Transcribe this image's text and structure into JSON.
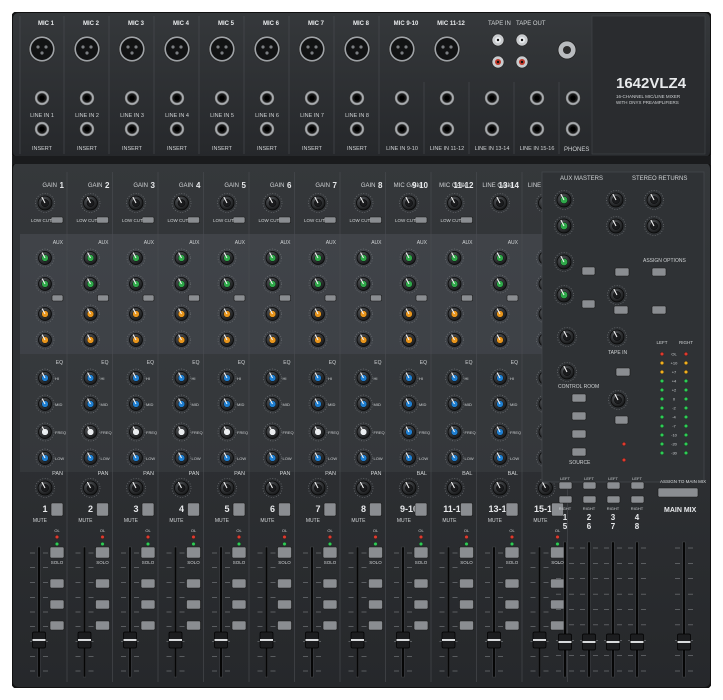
{
  "brand": {
    "model": "1642VLZ4",
    "tagline": "16-CHANNEL MIC/LINE MIXER",
    "tagline2": "WITH ONYX PREAMPLIFIERS"
  },
  "top_panel": {
    "mic_labels": [
      "MIC 1",
      "MIC 2",
      "MIC 3",
      "MIC 4",
      "MIC 5",
      "MIC 6",
      "MIC 7",
      "MIC 8",
      "MIC 9-10",
      "MIC 11-12"
    ],
    "line_in_labels": [
      "LINE IN 1",
      "LINE IN 2",
      "LINE IN 3",
      "LINE IN 4",
      "LINE IN 5",
      "LINE IN 6",
      "LINE IN 7",
      "LINE IN 8"
    ],
    "stereo_line_labels": [
      "LINE IN 9-10",
      "LINE IN 11-12",
      "LINE IN 13-14",
      "LINE IN 15-16"
    ],
    "insert_label": "INSERT",
    "tape_in": "TAPE IN",
    "tape_out": "TAPE OUT",
    "phones": "PHONES"
  },
  "channel_strip": {
    "gain": "GAIN",
    "mic_gain": "MIC GAIN",
    "line_gain": "LINE GAIN",
    "low_cut": "LOW CUT",
    "aux": "AUX",
    "eq": "EQ",
    "pan": "PAN",
    "bal": "BAL",
    "mute": "MUTE",
    "solo": "SOLO",
    "ol": "OL",
    "eq_labels": [
      "HI",
      "MID",
      "FREQ",
      "LOW"
    ],
    "channel_numbers": [
      "1",
      "2",
      "3",
      "4",
      "5",
      "6",
      "7",
      "8",
      "9-10",
      "11-12",
      "13-14",
      "15-16"
    ]
  },
  "master": {
    "aux_masters": "AUX MASTERS",
    "stereo_returns": "STEREO RETURNS",
    "assign_options": "ASSIGN OPTIONS",
    "control_room": "CONTROL ROOM",
    "tape_in": "TAPE IN",
    "source": "SOURCE",
    "left": "LEFT",
    "right": "RIGHT",
    "assign_to_main_mix": "ASSIGN TO MAIN MIX",
    "main_mix": "MAIN MIX",
    "sub_numbers": [
      "1",
      "2",
      "3",
      "4"
    ],
    "sub_numbers_b": [
      "5",
      "6",
      "7",
      "8"
    ],
    "meter_scale": [
      "OL",
      "+10",
      "+7",
      "+4",
      "+2",
      "0",
      "-2",
      "-4",
      "-7",
      "-10",
      "-20",
      "-30"
    ]
  },
  "colors": {
    "panel": "#2b2d30",
    "aux_knob_green": "#2fa84a",
    "aux_knob_orange": "#e8951c",
    "eq_knob_blue": "#1f7fd1",
    "eq_knob_white": "#e9ecef"
  }
}
